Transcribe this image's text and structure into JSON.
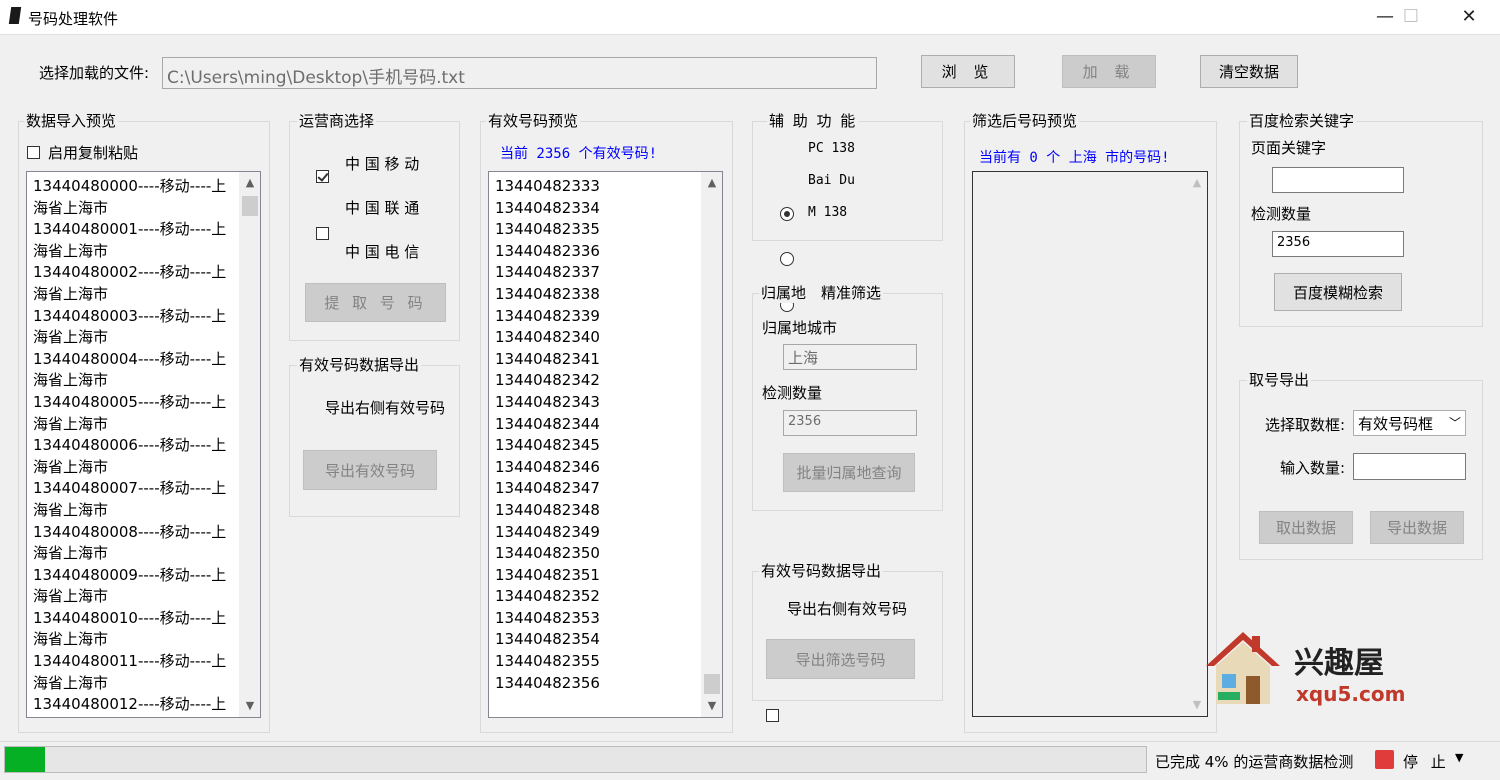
{
  "window": {
    "title": "号码处理软件",
    "minimize": "—",
    "maximize": "☐",
    "close": "✕"
  },
  "file_row": {
    "label": "选择加载的文件:",
    "path": "C:\\Users\\ming\\Desktop\\手机号码.txt",
    "browse": "浏 览",
    "load": "加 载",
    "clear": "清空数据"
  },
  "import_preview": {
    "title": "数据导入预览",
    "enable_paste": "启用复制粘贴",
    "lines": [
      "13440480000----移动----上",
      "海省上海市",
      "13440480001----移动----上",
      "海省上海市",
      "13440480002----移动----上",
      "海省上海市",
      "13440480003----移动----上",
      "海省上海市",
      "13440480004----移动----上",
      "海省上海市",
      "13440480005----移动----上",
      "海省上海市",
      "13440480006----移动----上",
      "海省上海市",
      "13440480007----移动----上",
      "海省上海市",
      "13440480008----移动----上",
      "海省上海市",
      "13440480009----移动----上",
      "海省上海市",
      "13440480010----移动----上",
      "海省上海市",
      "13440480011----移动----上",
      "海省上海市",
      "13440480012----移动----上"
    ]
  },
  "carrier": {
    "title": "运营商选择",
    "options": [
      {
        "label": "中 国 移 动",
        "checked": true
      },
      {
        "label": "中 国 联 通",
        "checked": false
      },
      {
        "label": "中 国 电 信",
        "checked": false
      }
    ],
    "extract": "提 取 号 码"
  },
  "valid_export": {
    "title": "有效号码数据导出",
    "checkbox": "导出右侧有效号码",
    "button": "导出有效号码"
  },
  "valid_preview": {
    "title": "有效号码预览",
    "count_text": "当前 2356 个有效号码!",
    "numbers": [
      "13440482333",
      "13440482334",
      "13440482335",
      "13440482336",
      "13440482337",
      "13440482338",
      "13440482339",
      "13440482340",
      "13440482341",
      "13440482342",
      "13440482343",
      "13440482344",
      "13440482345",
      "13440482346",
      "13440482347",
      "13440482348",
      "13440482349",
      "13440482350",
      "13440482351",
      "13440482352",
      "13440482353",
      "13440482354",
      "13440482355",
      "13440482356"
    ]
  },
  "aux": {
    "title": "辅 助 功 能",
    "options": [
      {
        "label": "PC 138",
        "checked": true
      },
      {
        "label": "Bai Du",
        "checked": false
      },
      {
        "label": "M 138",
        "checked": false
      }
    ]
  },
  "location": {
    "title": "归属地　精准筛选",
    "city_label": "归属地城市",
    "city_value": "上海",
    "count_label": "检测数量",
    "count_value": "2356",
    "button": "批量归属地查询"
  },
  "filtered_export": {
    "title": "有效号码数据导出",
    "checkbox": "导出右侧有效号码",
    "button": "导出筛选号码"
  },
  "filtered_preview": {
    "title": "筛选后号码预览",
    "count_text": "当前有 0 个 上海 市的号码!"
  },
  "baidu": {
    "title": "百度检索关键字",
    "keyword_label": "页面关键字",
    "keyword_value": "",
    "count_label": "检测数量",
    "count_value": "2356",
    "button": "百度模糊检索"
  },
  "take_export": {
    "title": "取号导出",
    "select_label": "选择取数框:",
    "select_value": "有效号码框",
    "qty_label": "输入数量:",
    "qty_value": "",
    "take_btn": "取出数据",
    "export_btn": "导出数据"
  },
  "watermark": {
    "brand": "兴趣屋",
    "url": "xqu5.com"
  },
  "status": {
    "progress_fraction": 0.035,
    "text": "已完成 4% 的运营商数据检测",
    "stop": "停 止"
  },
  "colors": {
    "progress": "#06b025",
    "accent_text": "#0000ff",
    "stop_icon": "#e03c3c"
  }
}
